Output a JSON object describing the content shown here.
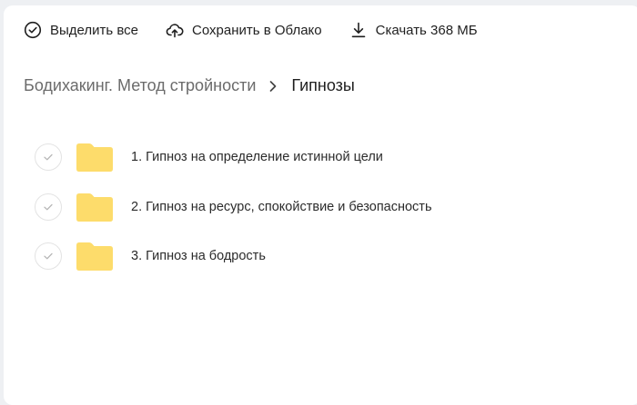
{
  "toolbar": {
    "select_all_label": "Выделить все",
    "save_cloud_label": "Сохранить в Облако",
    "download_label": "Скачать 368 МБ",
    "icons": [
      "check-circle-icon",
      "cloud-upload-icon",
      "download-icon"
    ]
  },
  "breadcrumb": {
    "parent": "Бодихакинг. Метод стройности",
    "separator_icon": "chevron-right-icon",
    "current": "Гипнозы"
  },
  "files": [
    {
      "name": "1. Гипноз на определение истинной цели",
      "selected": false,
      "icon": "folder-icon"
    },
    {
      "name": "2. Гипноз на ресурс, спокойствие и безопасность",
      "selected": false,
      "icon": "folder-icon"
    },
    {
      "name": "3. Гипноз на бодрость",
      "selected": false,
      "icon": "folder-icon"
    }
  ],
  "colors": {
    "folder": "#fddc6b",
    "text": "#1f1f1f",
    "muted": "#6b6b6b",
    "check_border": "#e3e3e3",
    "background": "#eef0f3"
  }
}
